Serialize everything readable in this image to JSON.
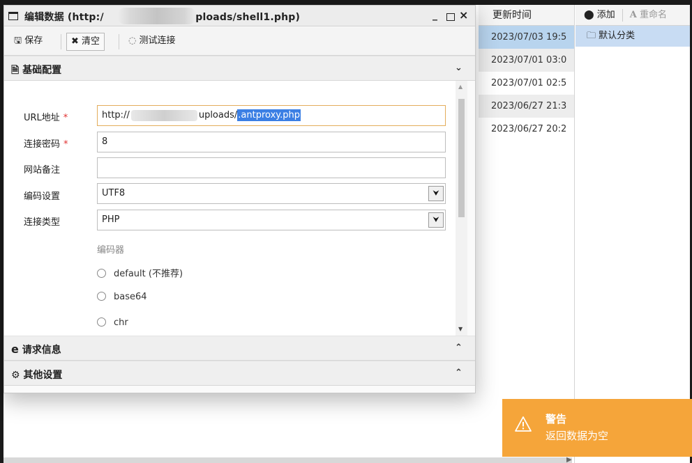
{
  "background": {
    "table_header": "更新时间",
    "rows": [
      "2023/07/03 19:5",
      "2023/07/01 03:0",
      "2023/07/01 02:5",
      "2023/06/27 21:3",
      "2023/06/27 20:2"
    ],
    "category_toolbar": {
      "add_label": "添加",
      "rename_label": "重命名"
    },
    "category_item": "默认分类"
  },
  "dialog": {
    "title_prefix": "编辑数据 (http:/",
    "title_suffix": "/uploads/shell1.php)",
    "minimize_glyph": "_",
    "close_glyph": "×",
    "toolbar": {
      "save_label": "保存",
      "clear_label": "清空",
      "test_label": "测试连接"
    },
    "sections": {
      "basic": "基础配置",
      "request": "请求信息",
      "other": "其他设置"
    },
    "form": {
      "url_label": "URL地址",
      "url_prefix": "http://",
      "url_middle": "uploads/",
      "url_selected": ".antproxy.php",
      "password_label": "连接密码",
      "password_value": "8",
      "note_label": "网站备注",
      "note_value": "",
      "encoding_label": "编码设置",
      "encoding_value": "UTF8",
      "type_label": "连接类型",
      "type_value": "PHP",
      "encoder_label": "编码器",
      "encoders": [
        "default (不推荐)",
        "base64",
        "chr"
      ],
      "required_mark": "*"
    }
  },
  "toast": {
    "title": "警告",
    "message": "返回数据为空",
    "color": "#f5a53a"
  }
}
